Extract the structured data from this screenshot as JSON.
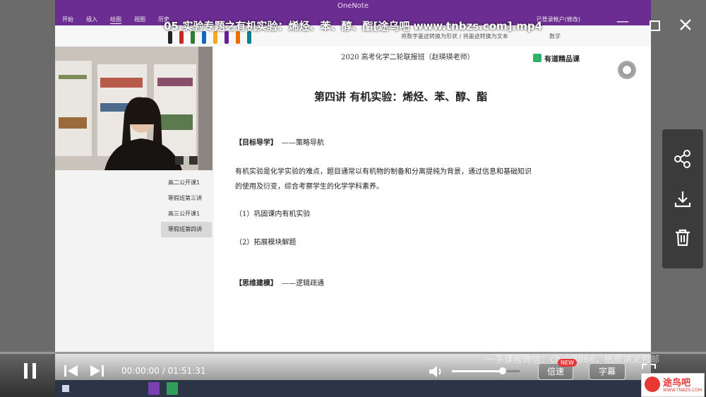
{
  "video": {
    "title": "05.实验专题之有机实验：烯烃、苯、醇、酯[途乌吧 www.tnbzs.com].mp4",
    "time_current": "00:00:00",
    "time_total": "01:51:31",
    "time_separator": "/",
    "speed_label": "倍速",
    "speed_badge": "NEW",
    "subtitle_label": "字幕",
    "volume_fraction": 0.75,
    "progress_fraction": 0.0,
    "overlay_watermark": "一手课程微信：chek8866，纸质讲义包邮"
  },
  "side_panel": {
    "icons": [
      "share-icon",
      "download-icon",
      "delete-icon"
    ]
  },
  "onenote": {
    "app_title": "OneNote",
    "account": "已登录帐户(修改)",
    "menu": [
      "开始",
      "插入",
      "绘图",
      "视图",
      "历史"
    ],
    "ribbon_text1": "将数字墨迹转换为形状 / 将墨迹转换为文本",
    "ribbon_text2": "数学",
    "pages": [
      "高二公开课1",
      "寒假班第三讲",
      "高三公开课1",
      "寒假班第四讲"
    ],
    "selected_page": 3
  },
  "document": {
    "header": "2020 高考化学二轮联报班（赵瑛瑛老师）",
    "brand": "有道精品课",
    "title": "第四讲  有机实验：烯烃、苯、醇、酯",
    "section1_heading": "【目标导学】",
    "section1_sub": "——策略导航",
    "paragraph_line1": "有机实验是化学实验的难点，题目通常以有机物的制备和分离提纯为背景，通过信息和基础知识",
    "paragraph_line2": "的使用及衍变，综合考察学生的化学学科素养。",
    "item1": "（1）巩固课内有机实验",
    "item2": "（2）拓展模块解题",
    "section2_heading": "【思维建模】",
    "section2_sub": "——逻辑疏通"
  },
  "logo": {
    "text": "途鸟吧",
    "url_text": "WWW.TNBZS.COM"
  },
  "colors": {
    "onenote_purple": "#6b2d92",
    "badge_red": "#e53935",
    "brand_green": "#2fb36b"
  }
}
